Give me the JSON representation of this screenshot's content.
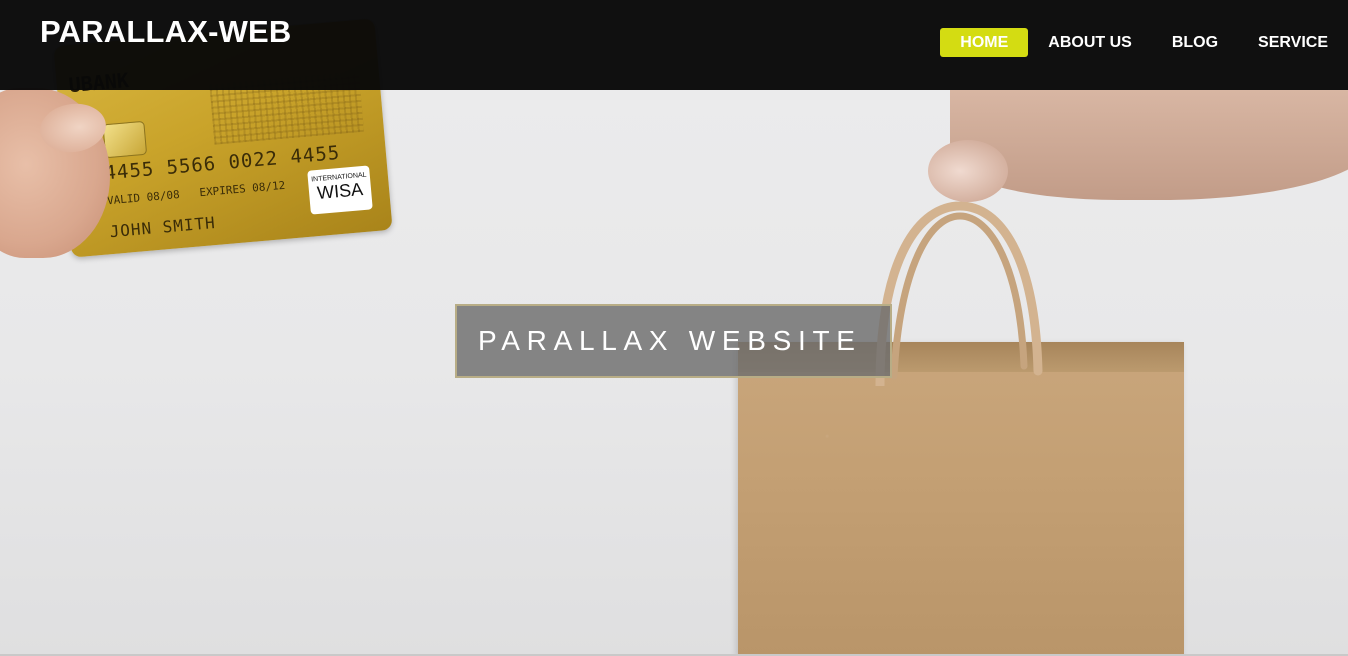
{
  "header": {
    "brand": "PARALLAX-WEB",
    "nav": [
      {
        "label": "HOME",
        "active": true
      },
      {
        "label": "ABOUT US",
        "active": false
      },
      {
        "label": "BLOG",
        "active": false
      },
      {
        "label": "SERVICE",
        "active": false
      }
    ],
    "active_color": "#d4dc12"
  },
  "hero": {
    "title": "PARALLAX WEBSITE",
    "card": {
      "bank": "UBANK",
      "number": "4455 5566 0022 4455",
      "valid_from": "08/08",
      "expires_end": "08/12",
      "name": "JOHN SMITH",
      "logo_small": "INTERNATIONAL",
      "logo_big": "WISA"
    }
  }
}
